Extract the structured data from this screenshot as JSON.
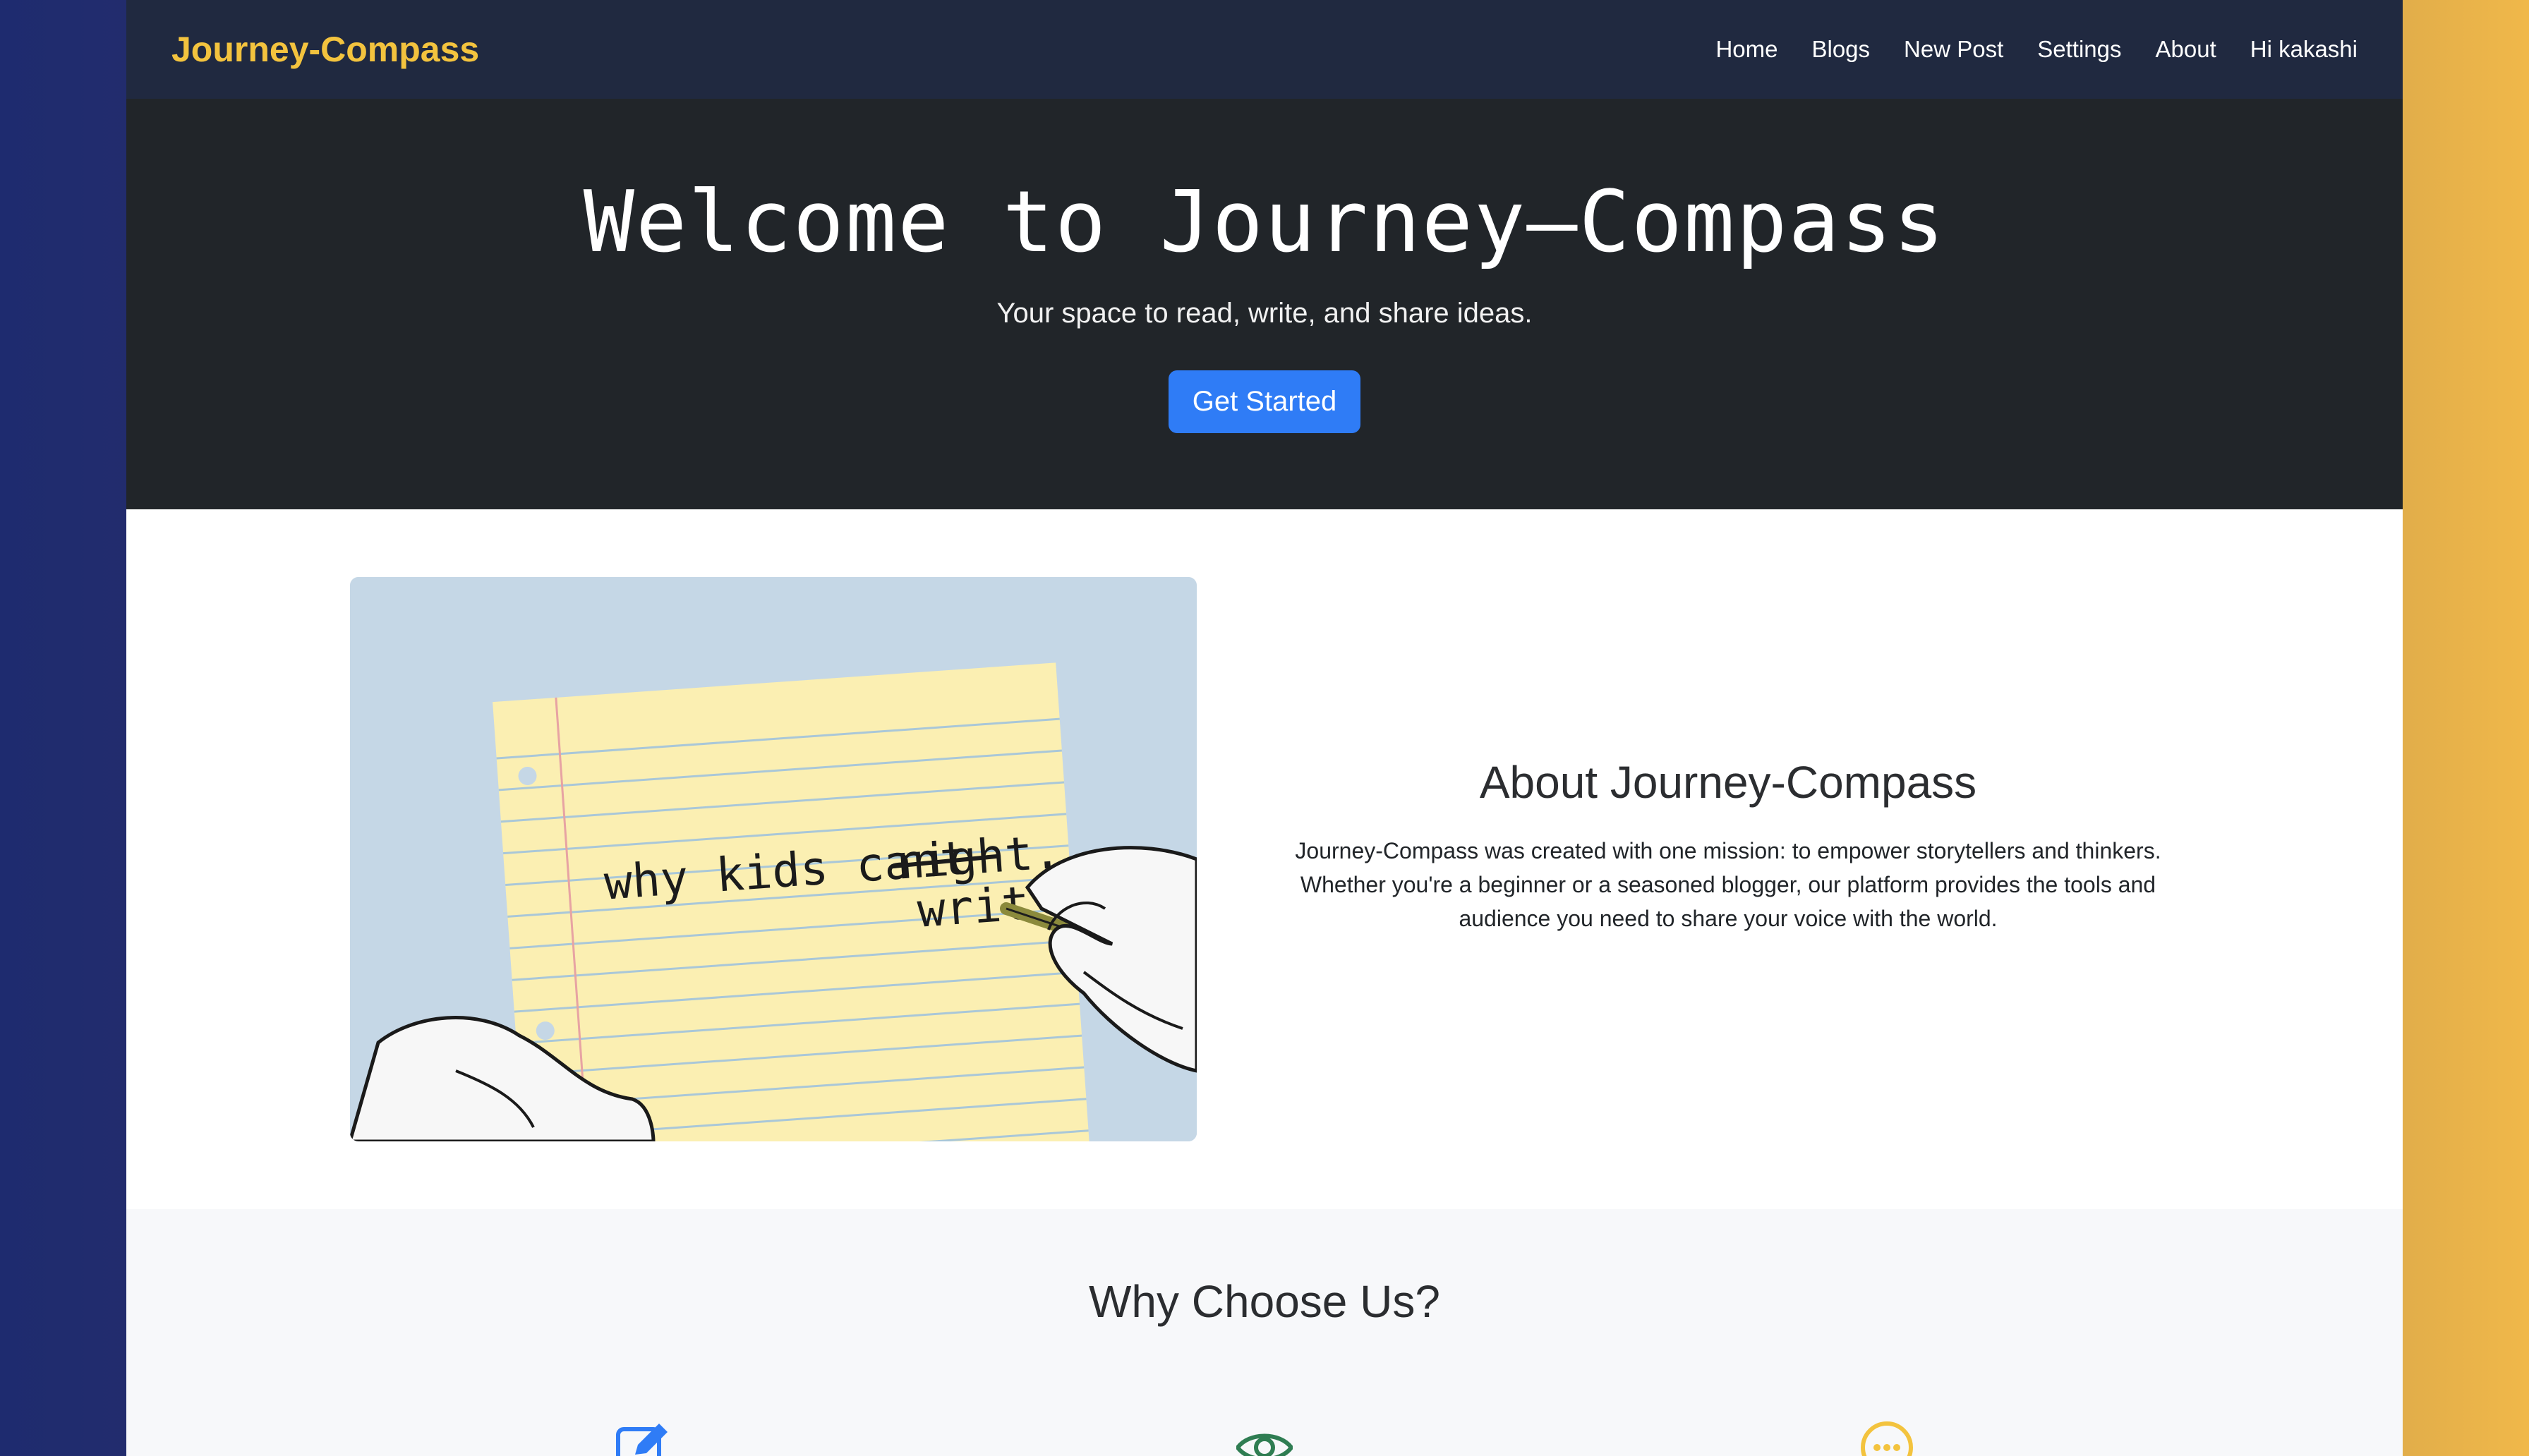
{
  "navbar": {
    "brand": "Journey-Compass",
    "links": [
      "Home",
      "Blogs",
      "New Post",
      "Settings",
      "About",
      "Hi kakashi"
    ]
  },
  "hero": {
    "title": "Welcome to Journey—Compass",
    "subtitle": "Your space to read, write, and share ideas.",
    "button_label": "Get Started"
  },
  "about": {
    "image_text_line1": "why kids cant",
    "image_text_struck": "right.",
    "image_text_line2": "writ",
    "title": "About Journey-Compass",
    "body_line1": "Journey-Compass was created with one mission: to empower storytellers and thinkers.",
    "body_line2": "Whether you're a beginner or a seasoned blogger, our platform provides the tools and",
    "body_line3": "audience you need to share your voice with the world."
  },
  "why": {
    "title": "Why Choose Us?",
    "icons": [
      "pencil-square-icon",
      "eye-icon",
      "chat-dots-icon"
    ]
  },
  "colors": {
    "brand": "#f3c33e",
    "navbar_bg": "#202940",
    "hero_bg": "#212529",
    "button": "#2f7cf6",
    "icon_blue": "#2f7cf6",
    "icon_green": "#2f7d52",
    "icon_yellow": "#f3c33e"
  }
}
